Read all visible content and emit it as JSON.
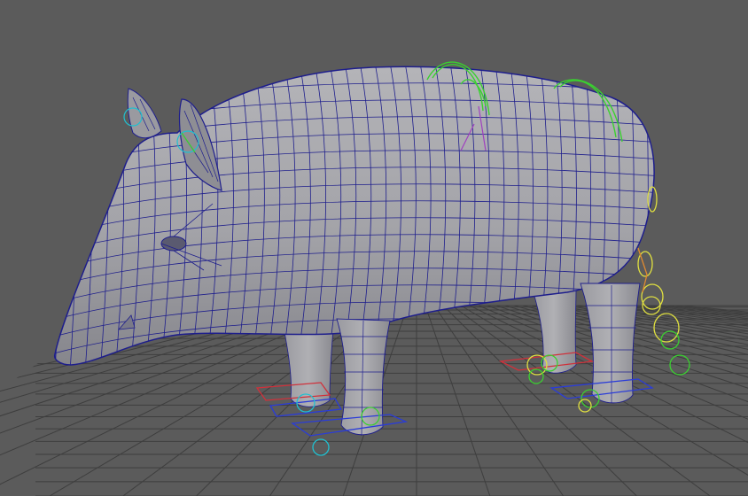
{
  "viewport": {
    "background": "#5b5b5b",
    "grid_color": "#3c3c3c",
    "mesh_fill": "#a6a6aa",
    "mesh_wire": "#1e1e8c",
    "ctrl_red": "#d0303a",
    "ctrl_blue": "#2a3cd8",
    "ctrl_green": "#3ad030",
    "ctrl_yellow": "#e0e040",
    "ctrl_orange": "#e08a30",
    "ctrl_cyan": "#20c0d0",
    "ctrl_purple": "#a040c0"
  },
  "scene": {
    "model": "boar-mesh",
    "controls": [
      "head-control-icon",
      "ear-control-icon",
      "spine-control-icon",
      "tail-control-icon",
      "foot-control-icon"
    ]
  }
}
